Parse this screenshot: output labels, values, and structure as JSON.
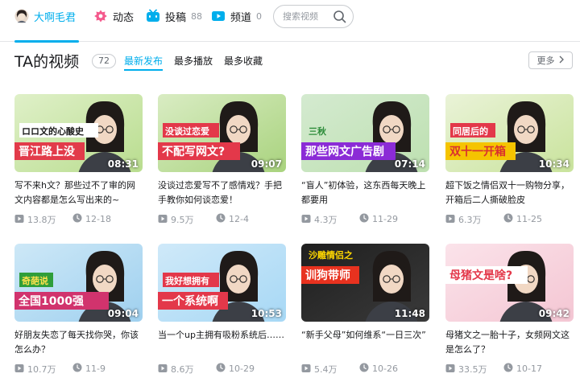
{
  "nav": {
    "user_name": "大啊毛君",
    "dynamic_label": "动态",
    "post_label": "投稿",
    "post_count": "88",
    "channel_label": "频道",
    "channel_count": "0",
    "search_placeholder": "搜索视频",
    "accent_color": "#00aeec"
  },
  "section": {
    "title": "TA的视频",
    "count": "72",
    "tabs": [
      "最新发布",
      "最多播放",
      "最多收藏"
    ],
    "active_tab": "最新发布",
    "more_label": "更多"
  },
  "videos": [
    {
      "cover_text": "晋江路上没",
      "cover_subtext": "ロロ文的心酸史",
      "duration": "08:31",
      "title": "写不来h文？那些过不了审的网文内容都是怎么写出来的~",
      "views": "13.8万",
      "date": "12-18"
    },
    {
      "cover_text": "不配写网文?",
      "cover_subtext": "没谈过恋爱",
      "duration": "09:07",
      "title": "没谈过恋爱写不了感情戏？手把手教你如何谈恋爱！",
      "views": "9.5万",
      "date": "12-4"
    },
    {
      "cover_text": "那些网文广告剧",
      "cover_subtext": "三秋",
      "duration": "07:14",
      "title": "“盲人”初体验，这东西每天晚上都要用",
      "views": "4.3万",
      "date": "11-29"
    },
    {
      "cover_text": "双十一开箱",
      "cover_subtext": "同居后的",
      "duration": "10:34",
      "title": "超下饭之情侣双十一购物分享，开箱后二人撕破脸皮",
      "views": "6.3万",
      "date": "11-25"
    },
    {
      "cover_text": "全国1000强",
      "cover_subtext": "奇葩说",
      "duration": "09:04",
      "title": "好朋友失恋了每天找你哭，你该怎么办？",
      "views": "10.7万",
      "date": "11-9"
    },
    {
      "cover_text": "一个系统啊",
      "cover_subtext": "我好想拥有",
      "duration": "10:53",
      "title": "当一个up主拥有吸粉系统后……",
      "views": "8.6万",
      "date": "10-29"
    },
    {
      "cover_text": "训狗带师",
      "cover_subtext": "沙雕情侣之",
      "duration": "11:48",
      "title": "“新手父母”如何维系“一日三次”",
      "views": "5.4万",
      "date": "10-26"
    },
    {
      "cover_text": "母猪文是啥?",
      "cover_subtext": "",
      "duration": "09:42",
      "title": "母猪文之一胎十子，女频网文这是怎么了？",
      "views": "33.5万",
      "date": "10-17"
    }
  ]
}
